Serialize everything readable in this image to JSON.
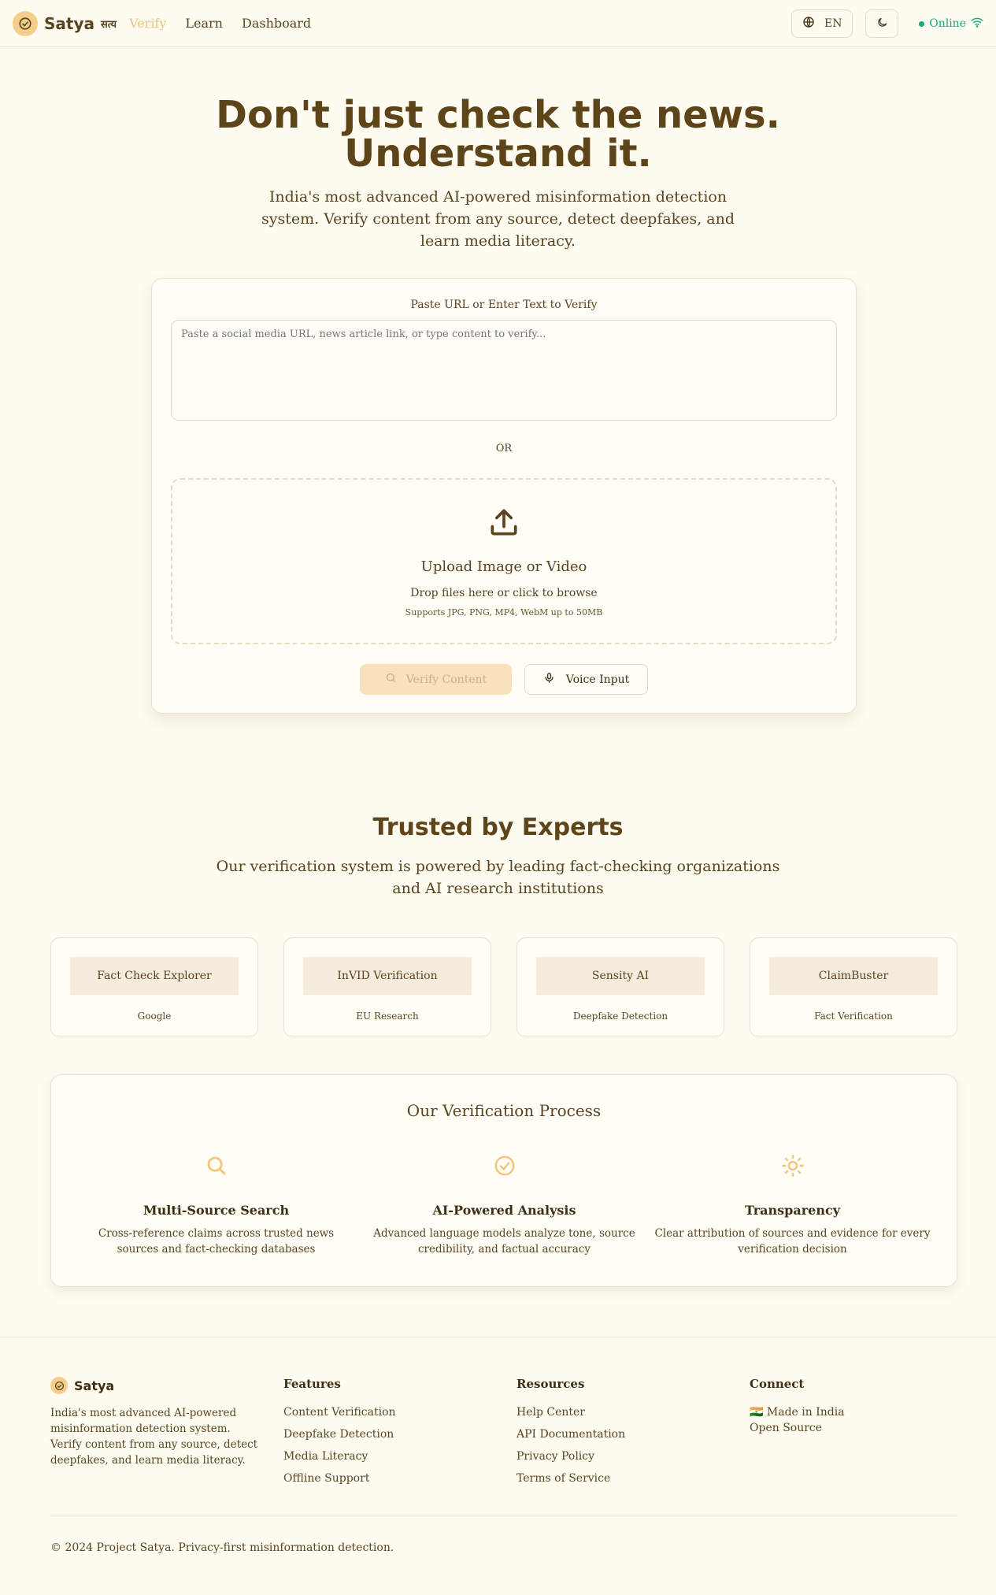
{
  "nav": {
    "brand_name": "Satya",
    "brand_sub": "सत्य",
    "links": [
      {
        "label": "Verify"
      },
      {
        "label": "Learn"
      },
      {
        "label": "Dashboard"
      }
    ],
    "language": "EN",
    "status": "Online"
  },
  "hero": {
    "title_line1": "Don't just check the news.",
    "title_line2": "Understand it.",
    "subtitle": "India's most advanced AI-powered misinformation detection system. Verify content from any source, detect deepfakes, and learn media literacy."
  },
  "verify": {
    "label": "Paste URL or Enter Text to Verify",
    "placeholder": "Paste a social media URL, news article link, or type content to verify...",
    "or": "OR",
    "upload_title": "Upload Image or Video",
    "upload_desc": "Drop files here or click to browse",
    "upload_note": "Supports JPG, PNG, MP4, WebM up to 50MB",
    "verify_button": "Verify Content",
    "voice_button": "Voice Input"
  },
  "trusted": {
    "title": "Trusted by Experts",
    "subtitle": "Our verification system is powered by leading fact-checking organizations and AI research institutions",
    "partners": [
      {
        "name": "Fact Check Explorer",
        "org": "Google"
      },
      {
        "name": "InVID Verification",
        "org": "EU Research"
      },
      {
        "name": "Sensity AI",
        "org": "Deepfake Detection"
      },
      {
        "name": "ClaimBuster",
        "org": "Fact Verification"
      }
    ]
  },
  "process": {
    "title": "Our Verification Process",
    "steps": [
      {
        "title": "Multi-Source Search",
        "desc": "Cross-reference claims across trusted news sources and fact-checking databases",
        "icon": "search-icon"
      },
      {
        "title": "AI-Powered Analysis",
        "desc": "Advanced language models analyze tone, source credibility, and factual accuracy",
        "icon": "check-circle-icon"
      },
      {
        "title": "Transparency",
        "desc": "Clear attribution of sources and evidence for every verification decision",
        "icon": "sun-icon"
      }
    ]
  },
  "footer": {
    "brand": "Satya",
    "desc": "India's most advanced AI-powered misinformation detection system. Verify content from any source, detect deepfakes, and learn media literacy.",
    "features_title": "Features",
    "features": [
      "Content Verification",
      "Deepfake Detection",
      "Media Literacy",
      "Offline Support"
    ],
    "resources_title": "Resources",
    "resources": [
      "Help Center",
      "API Documentation",
      "Privacy Policy",
      "Terms of Service"
    ],
    "connect_title": "Connect",
    "connect": [
      "🇮🇳 Made in India",
      "Open Source"
    ],
    "copyright": "© 2024 Project Satya. Privacy-first misinformation detection."
  },
  "colors": {
    "background": "#fefbf0",
    "accent": "#f5cf8a",
    "text": "#5a4420",
    "online": "#1aa87a"
  }
}
